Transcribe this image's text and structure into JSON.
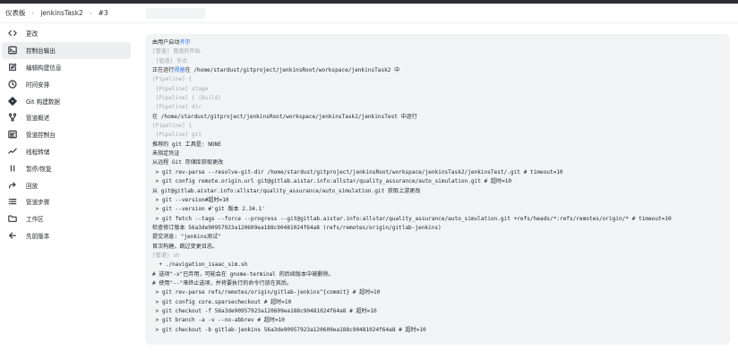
{
  "breadcrumb": {
    "items": [
      "仪表板",
      "jenkinsTask2",
      "#3"
    ],
    "separator": "›"
  },
  "sidebar": {
    "items": [
      {
        "label": "更改",
        "icon": "code-icon"
      },
      {
        "label": "控制台输出",
        "icon": "terminal-icon",
        "active": true
      },
      {
        "label": "编辑构建信息",
        "icon": "edit-icon"
      },
      {
        "label": "时间安排",
        "icon": "clock-icon"
      },
      {
        "label": "Git 构建数据",
        "icon": "git-icon"
      },
      {
        "label": "管道概述",
        "icon": "pipeline-icon"
      },
      {
        "label": "管道控制台",
        "icon": "console-icon"
      },
      {
        "label": "线程转储",
        "icon": "pulse-icon"
      },
      {
        "label": "暂停/恢复",
        "icon": "pause-icon"
      },
      {
        "label": "回放",
        "icon": "replay-icon"
      },
      {
        "label": "管道步骤",
        "icon": "list-icon"
      },
      {
        "label": "工作区",
        "icon": "folder-icon"
      },
      {
        "label": "先前版本",
        "icon": "arrow-left-icon"
      }
    ]
  },
  "console": {
    "lines": [
      {
        "pre": "由用户启动",
        "link": "齐尔",
        "post": ""
      },
      {
        "text": "[管道] 管道的开始",
        "muted": true
      },
      {
        "text": " [管道] 节点",
        "muted": true
      },
      {
        "pre": "正在运行",
        "link": "视留",
        "post": "在 /home/stardust/gitproject/jenkinsRoot/workspace/jenkinsTask2 中"
      },
      {
        "text": "[Pipeline] {",
        "muted": true
      },
      {
        "text": " [Pipeline] stage",
        "muted": true
      },
      {
        "text": " [Pipeline] { (Build)",
        "muted": true
      },
      {
        "text": " [Pipeline] dir",
        "muted": true
      },
      {
        "text": "在 /home/stardust/gitproject/jenkinsRoot/workspace/jenkinsTask2/jenkinsTest 中运行"
      },
      {
        "text": "[Pipeline] {",
        "muted": true
      },
      {
        "text": " [Pipeline] git",
        "muted": true
      },
      {
        "text": "推荐的 git 工具是: NONE"
      },
      {
        "text": "未指定凭证"
      },
      {
        "text": "从远程 Git 存储库获取更改"
      },
      {
        "text": " > git rev-parse --resolve-git-dir /home/stardust/gitproject/jenkinsRoot/workspace/jenkinsTask2/jenkinsTest/.git # timeout=10"
      },
      {
        "text": " > git config remote.origin.url git@gitlab.aistar.info:allstar/quality_assurance/auto_simulation.git # 超时=10"
      },
      {
        "text": "从 git@gitlab.aistar.info:allstar/quality_assurance/auto_simulation.git 获取上游更改"
      },
      {
        "text": " > git --version#超时=10"
      },
      {
        "text": " > git --version #'git 版本 2.34.1'"
      },
      {
        "text": " > git fetch --tags --force --progress --git@gitlab.aistar.info:allstar/quality_assurance/auto_simulation.git +refs/heads/*:refs/remotes/origin/* # timeout=10"
      },
      {
        "text": "检查修订版本 56a3de90957923a120609ea188c90481024f64a8 (refs/remotes/origin/gitlab-jenkins)"
      },
      {
        "text": "提交消息: \"jenkins测试\""
      },
      {
        "text": "首次构建。跳过变更日志。"
      },
      {
        "text": "[管道] sh",
        "muted": true
      },
      {
        "text": "  + ./navigation_isaac_sim.sh"
      },
      {
        "text": "# 选项\"-x\"已弃用，可能会在 gnome-terminal 的后续版本中被删除。"
      },
      {
        "text": "# 使用\"--\"来终止选项，并将要执行的命令行放在其后。"
      },
      {
        "text": " > git rev-parse refs/remotes/origin/gitlab-jenkins^{commit} # 超时=10"
      },
      {
        "text": " > git config core.sparsecheckout # 超时=10"
      },
      {
        "text": " > git checkout -f 56a3de90957923a120609ea188c90481024f64a8 # 超时=10"
      },
      {
        "text": " > git branch -a -v --no-abbrev # 超时=10"
      },
      {
        "text": " > git checkout -b gitlab-jenkins 56a3de90957923a120609ea188c90481024f64a8 # 超时=10"
      }
    ]
  }
}
